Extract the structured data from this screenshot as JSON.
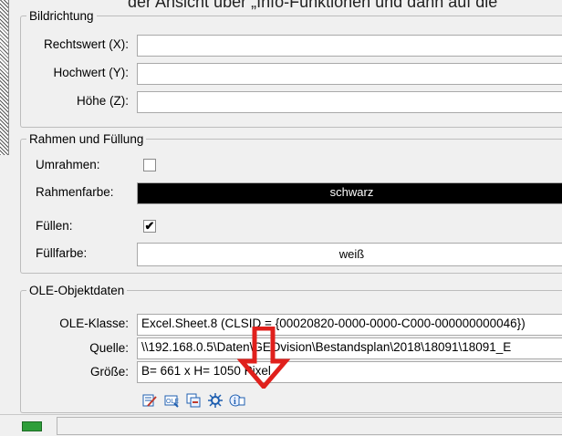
{
  "top_text": "der Ansicht über „Info-Funktionen und dann auf die",
  "bildrichtung": {
    "legend": "Bildrichtung",
    "rechtswert_label": "Rechtswert (X):",
    "rechtswert_value": "",
    "hochwert_label": "Hochwert (Y):",
    "hochwert_value": "",
    "hoehe_label": "Höhe (Z):",
    "hoehe_value": ""
  },
  "rahmen": {
    "legend": "Rahmen und Füllung",
    "umrahmen_label": "Umrahmen:",
    "umrahmen_checked": false,
    "rahmenfarbe_label": "Rahmenfarbe:",
    "rahmenfarbe_value": "schwarz",
    "rahmenfarbe_color": "#000000",
    "fuellen_label": "Füllen:",
    "fuellen_checked": true,
    "fuellen_mark": "✔",
    "fuellfarbe_label": "Füllfarbe:",
    "fuellfarbe_value": "weiß",
    "fuellfarbe_color": "#ffffff"
  },
  "ole": {
    "legend": "OLE-Objektdaten",
    "klasse_label": "OLE-Klasse:",
    "klasse_value": "Excel.Sheet.8 (CLSID = {00020820-0000-0000-C000-000000000046})",
    "quelle_label": "Quelle:",
    "quelle_value": "\\\\192.168.0.5\\Daten\\GEOvision\\Bestandsplan\\2018\\18091\\18091_E",
    "groesse_label": "Größe:",
    "groesse_value": "B= 661 x H= 1050 Pixel",
    "toolbar_icons": [
      "ole-edit-icon",
      "ole-properties-icon",
      "ole-update-icon",
      "ole-settings-icon",
      "ole-info-icon"
    ]
  },
  "annotation": {
    "arrow_color": "#e0201c"
  },
  "status": {
    "led_color": "#2e9e3a"
  }
}
